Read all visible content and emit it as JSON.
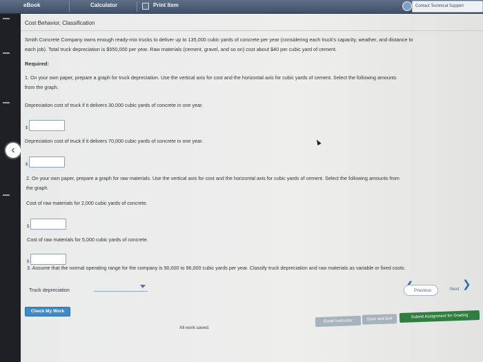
{
  "toolbar": {
    "ebook": "eBook",
    "calculator": "Calculator",
    "print_item": "Print Item",
    "contact": "Contact Technical Support"
  },
  "problem": {
    "title": "Cost Behavior, Classification",
    "intro_line1": "Smith Concrete Company owns enough ready-mix trucks to deliver up to 135,000 cubic yards of concrete per year (considering each truck's capacity, weather, and distance to",
    "intro_line2": "each job). Total truck depreciation is $550,000 per year. Raw materials (cement, gravel, and so on) cost about $40 per cubic yard of cement.",
    "required": "Required:",
    "q1_line1": "1.  On your own paper, prepare a graph for truck depreciation. Use the vertical axis for cost and the horizontal axis for cubic yards of cement. Select the following amounts",
    "q1_line2": "from the graph.",
    "q1a": "Depreciation cost of truck if it delivers 30,000 cubic yards of concrete in one year.",
    "q1b": "Depreciation cost of truck if it delivers 70,000 cubic yards of concrete in one year.",
    "q2_line1": "2.  On your own paper, prepare a graph for raw materials. Use the vertical axis for cost and the horizontal axis for cubic yards of cement. Select the following amounts from",
    "q2_line2": "the graph.",
    "q2a": "Cost of raw materials for 2,000 cubic yards of concrete.",
    "q2b": "Cost of raw materials for 5,000 cubic yards of concrete.",
    "q3": "3.  Assume that the normal operating range for the company is 90,000 to 96,000 cubic yards per year. Classify truck depreciation and raw materials as variable or fixed costs.",
    "truck_dep_label": "Truck depreciation",
    "dollar": "$"
  },
  "inputs": {
    "q1a_value": "",
    "q1b_value": "",
    "q2a_value": "",
    "q2b_value": "",
    "truck_dep_selected": ""
  },
  "nav": {
    "previous": "Previous",
    "next": "Next"
  },
  "footer": {
    "check_work": "Check My Work",
    "status": "All work saved.",
    "email": "Email Instructor",
    "save_exit": "Save and Exit",
    "submit": "Submit Assignment for Grading"
  },
  "colors": {
    "toolbar": "#4a5c75",
    "check_button": "#3d8bc9",
    "submit_button": "#2f7d3f"
  }
}
